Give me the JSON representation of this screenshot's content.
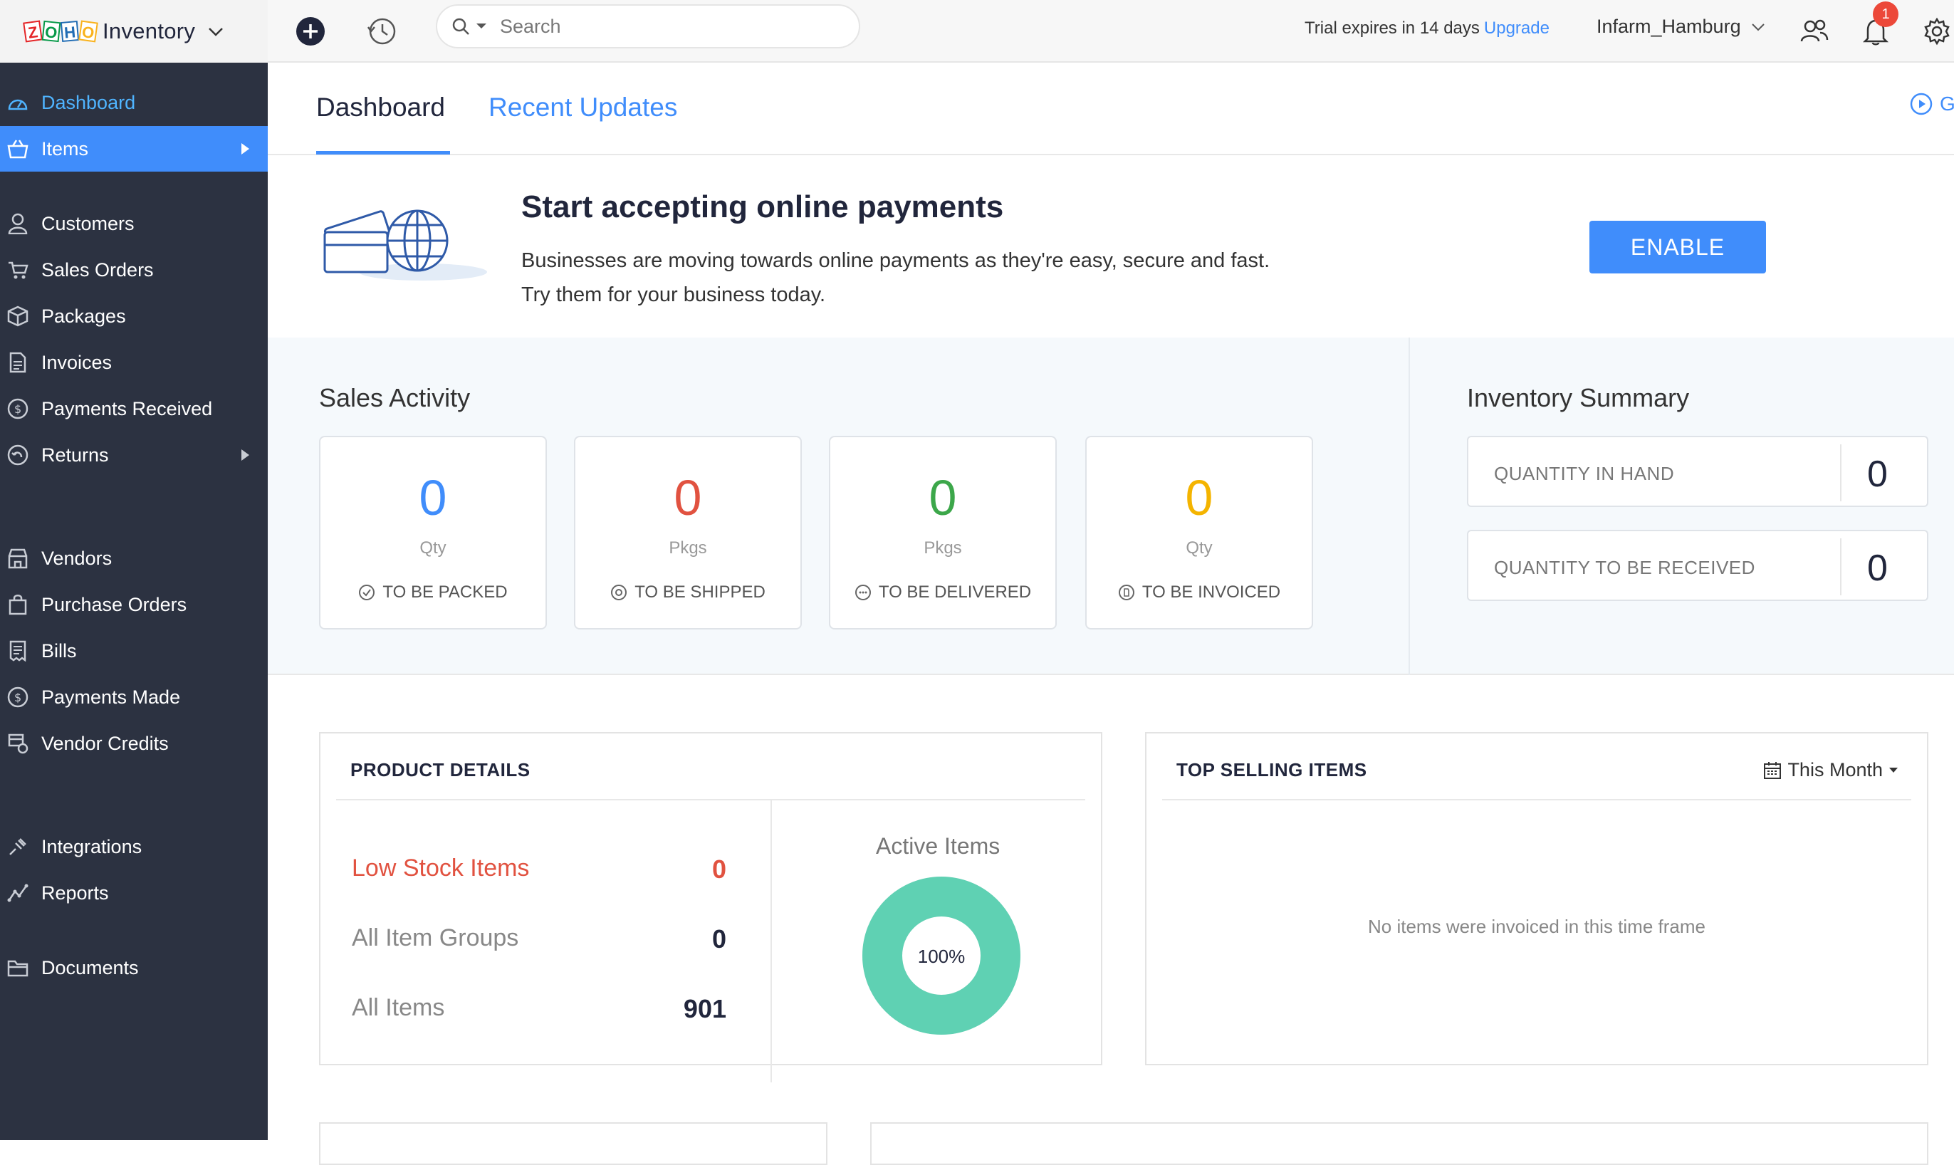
{
  "topbar": {
    "app_name": "Inventory",
    "search_placeholder": "Search",
    "trial_text": "Trial expires in 14 days",
    "upgrade_label": "Upgrade",
    "org_name": "Infarm_Hamburg",
    "notification_count": "1"
  },
  "sidebar": {
    "items": [
      {
        "label": "Dashboard",
        "icon": "dashboard-icon"
      },
      {
        "label": "Items",
        "icon": "basket-icon"
      },
      {
        "label": "Customers",
        "icon": "user-icon"
      },
      {
        "label": "Sales Orders",
        "icon": "cart-icon"
      },
      {
        "label": "Packages",
        "icon": "package-icon"
      },
      {
        "label": "Invoices",
        "icon": "invoice-icon"
      },
      {
        "label": "Payments Received",
        "icon": "payment-received-icon"
      },
      {
        "label": "Returns",
        "icon": "returns-icon"
      },
      {
        "label": "Vendors",
        "icon": "vendor-icon"
      },
      {
        "label": "Purchase Orders",
        "icon": "shopping-bag-icon"
      },
      {
        "label": "Bills",
        "icon": "bill-icon"
      },
      {
        "label": "Payments Made",
        "icon": "payment-made-icon"
      },
      {
        "label": "Vendor Credits",
        "icon": "vendor-credit-icon"
      },
      {
        "label": "Integrations",
        "icon": "integrations-icon"
      },
      {
        "label": "Reports",
        "icon": "reports-icon"
      },
      {
        "label": "Documents",
        "icon": "folder-icon"
      }
    ]
  },
  "tabs": {
    "dashboard": "Dashboard",
    "recent_updates": "Recent Updates",
    "get_started": "G"
  },
  "banner": {
    "title": "Start accepting online payments",
    "line1": "Businesses are moving towards online payments as they're easy, secure and fast.",
    "line2": "Try them for your business today.",
    "button": "ENABLE"
  },
  "sales_activity": {
    "title": "Sales Activity",
    "cards": [
      {
        "value": "0",
        "unit": "Qty",
        "label": "TO BE PACKED",
        "color": "#408dfb"
      },
      {
        "value": "0",
        "unit": "Pkgs",
        "label": "TO BE SHIPPED",
        "color": "#e15240"
      },
      {
        "value": "0",
        "unit": "Pkgs",
        "label": "TO BE DELIVERED",
        "color": "#3ca74a"
      },
      {
        "value": "0",
        "unit": "Qty",
        "label": "TO BE INVOICED",
        "color": "#f4b400"
      }
    ]
  },
  "inventory_summary": {
    "title": "Inventory Summary",
    "rows": [
      {
        "label": "QUANTITY IN HAND",
        "value": "0"
      },
      {
        "label": "QUANTITY TO BE RECEIVED",
        "value": "0"
      }
    ]
  },
  "product_details": {
    "title": "PRODUCT DETAILS",
    "rows": [
      {
        "label": "Low Stock Items",
        "value": "0"
      },
      {
        "label": "All Item Groups",
        "value": "0"
      },
      {
        "label": "All Items",
        "value": "901"
      }
    ],
    "active_items_title": "Active Items",
    "active_items_percent": "100%",
    "active_fraction": 1.0,
    "donut_color": "#5fd1b3"
  },
  "top_selling": {
    "title": "TOP SELLING ITEMS",
    "period": "This Month",
    "empty_message": "No items were invoiced in this time frame"
  },
  "colors": {
    "accent": "#408dfb",
    "sidebar_bg": "#2c3241",
    "low_stock": "#e15240"
  }
}
